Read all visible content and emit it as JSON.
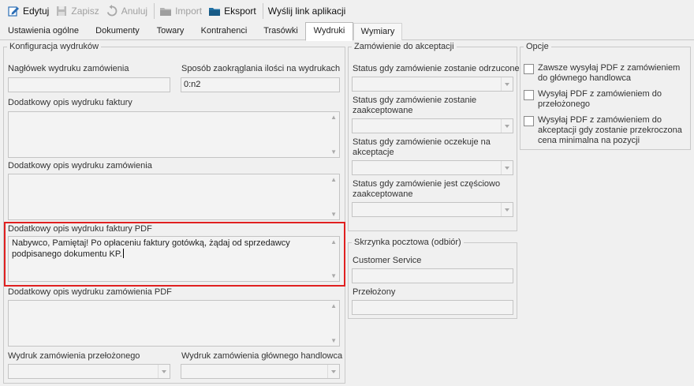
{
  "toolbar": {
    "edit": "Edytuj",
    "save": "Zapisz",
    "cancel": "Anuluj",
    "import": "Import",
    "export": "Eksport",
    "send_link": "Wyślij link aplikacji"
  },
  "tabs": [
    "Ustawienia ogólne",
    "Dokumenty",
    "Towary",
    "Kontrahenci",
    "Trasówki",
    "Wydruki",
    "Wymiary"
  ],
  "active_tab": "Wydruki",
  "print_config": {
    "legend": "Konfiguracja wydruków",
    "order_header_label": "Nagłówek wydruku zamówienia",
    "order_header_value": "",
    "rounding_label": "Sposób zaokrąglania ilości na wydrukach",
    "rounding_value": "0:n2",
    "invoice_desc_label": "Dodatkowy opis wydruku faktury",
    "order_desc_label": "Dodatkowy opis wydruku zamówienia",
    "invoice_pdf_desc_label": "Dodatkowy opis wydruku faktury PDF",
    "invoice_pdf_desc_value": "Nabywco, Pamiętaj! Po opłaceniu faktury gotówką, żądaj od sprzedawcy podpisanego dokumentu KP.",
    "order_pdf_desc_label": "Dodatkowy opis wydruku zamówienia PDF",
    "supervisor_print_label": "Wydruk zamówienia przełożonego",
    "main_trader_print_label": "Wydruk zamówienia głównego handlowca"
  },
  "acceptance": {
    "legend": "Zamówienie do akceptacji",
    "rejected_label": "Status gdy zamówienie zostanie odrzucone",
    "accepted_label": "Status gdy zamówienie zostanie zaakceptowane",
    "awaiting_label": "Status gdy zamówienie oczekuje na akceptacje",
    "partial_label": "Status gdy zamówienie jest częściowo zaakceptowane"
  },
  "mailbox": {
    "legend": "Skrzynka pocztowa (odbiór)",
    "customer_service_label": "Customer Service",
    "customer_service_value": "",
    "supervisor_label": "Przełożony",
    "supervisor_value": ""
  },
  "options": {
    "legend": "Opcje",
    "items": [
      {
        "label": "Zawsze wysyłaj PDF z zamówieniem do głównego handlowca",
        "checked": false
      },
      {
        "label": "Wysyłaj PDF z zamówieniem do przełożonego",
        "checked": false
      },
      {
        "label": "Wysyłaj PDF z zamówieniem do akceptacji gdy zostanie przekroczona cena minimalna na pozycji",
        "checked": false
      }
    ]
  },
  "colors": {
    "highlight": "#e02020",
    "tab_active_bg": "#ffffff",
    "window_bg": "#f0f0f0"
  },
  "icons": [
    "edit-icon",
    "save-icon",
    "undo-icon",
    "folder-import-icon",
    "folder-export-icon"
  ]
}
